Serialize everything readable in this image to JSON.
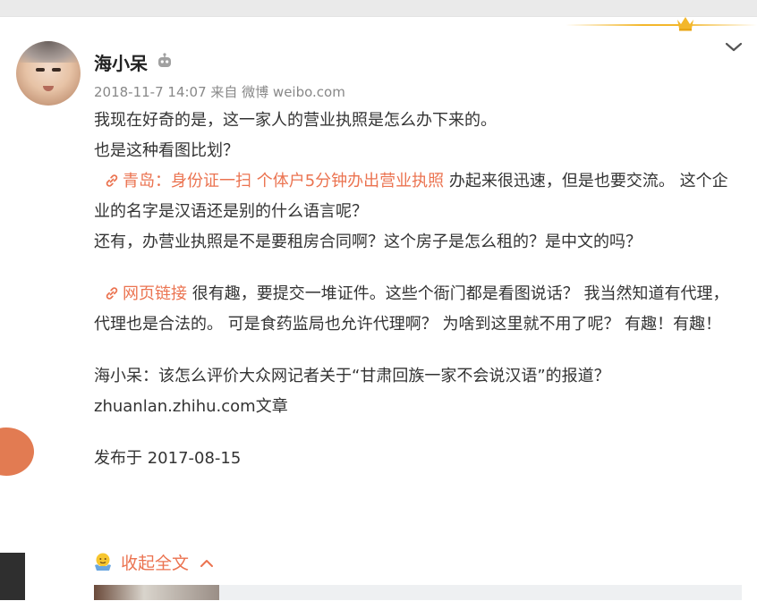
{
  "post": {
    "author": "海小呆",
    "meta": "2018-11-7 14:07 来自 微博 weibo.com",
    "line1": "我现在好奇的是，这一家人的营业执照是怎么办下来的。",
    "line2": "也是这种看图比划？",
    "link1_text": "青岛：身份证一扫 个体户5分钟办出营业执照",
    "para3_after_link": "办起来很迅速，但是也要交流。 这个企业的名字是汉语还是别的什么语言呢？",
    "line4": "还有，办营业执照是不是要租房合同啊？这个房子是怎么租的？是中文的吗？",
    "link2_text": "网页链接",
    "para5_after_link": "很有趣，要提交一堆证件。这些个衙门都是看图说话？ 我当然知道有代理，代理也是合法的。 可是食药监局也允许代理啊？ 为啥到这里就不用了呢？ 有趣！有趣！",
    "quote_line": "海小呆：该怎么评价大众网记者关于“甘肃回族一家不会说汉语”的报道？",
    "quote_source": "zhuanlan.zhihu.com文章",
    "published": "发布于 2017-08-15",
    "collapse_label": "收起全文"
  },
  "icons": {
    "crown": "crown-icon",
    "chevron": "chevron-down-icon",
    "robot": "robot-icon",
    "link": "link-icon",
    "emoji": "emoji-icon",
    "collapse_arrow": "chevron-up-icon"
  },
  "colors": {
    "link": "#eb7350",
    "meta": "#888888",
    "text": "#333333",
    "gold": "#f3b72b"
  }
}
